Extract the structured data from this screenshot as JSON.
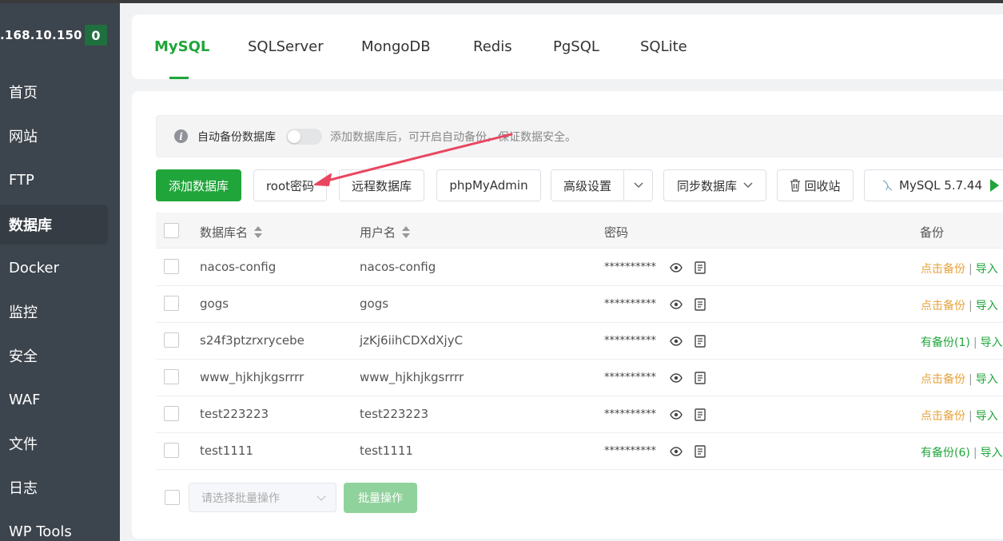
{
  "sidebar": {
    "server_ip": ".168.10.150",
    "badge": "0",
    "items": [
      {
        "label": "首页"
      },
      {
        "label": "网站"
      },
      {
        "label": "FTP"
      },
      {
        "label": "数据库"
      },
      {
        "label": "Docker"
      },
      {
        "label": "监控"
      },
      {
        "label": "安全"
      },
      {
        "label": "WAF"
      },
      {
        "label": "文件"
      },
      {
        "label": "日志"
      },
      {
        "label": "WP Tools"
      }
    ],
    "active_item": "数据库"
  },
  "tabs": [
    "MySQL",
    "SQLServer",
    "MongoDB",
    "Redis",
    "PgSQL",
    "SQLite"
  ],
  "active_tab": "MySQL",
  "notice": {
    "label": "自动备份数据库",
    "text": "添加数据库后，可开启自动备份，保证数据安全。",
    "toggle_on": false
  },
  "toolbar": {
    "add_db": "添加数据库",
    "root_pwd": "root密码",
    "remote_db": "远程数据库",
    "phpmyadmin": "phpMyAdmin",
    "advanced": "高级设置",
    "sync_db": "同步数据库",
    "recycle": "回收站",
    "mysql_version": "MySQL 5.7.44"
  },
  "table": {
    "headers": {
      "db_name": "数据库名",
      "username": "用户名",
      "password": "密码",
      "backup": "备份"
    },
    "rows": [
      {
        "db_name": "nacos-config",
        "username": "nacos-config",
        "password": "**********",
        "backup": "点击备份",
        "backup_state": "none",
        "import": "导入"
      },
      {
        "db_name": "gogs",
        "username": "gogs",
        "password": "**********",
        "backup": "点击备份",
        "backup_state": "none",
        "import": "导入"
      },
      {
        "db_name": "s24f3ptzrxrycebe",
        "username": "jzKj6iihCDXdXjyC",
        "password": "**********",
        "backup": "有备份(1)",
        "backup_state": "has",
        "import": "导入"
      },
      {
        "db_name": "www_hjkhjkgsrrrr",
        "username": "www_hjkhjkgsrrrr",
        "password": "**********",
        "backup": "点击备份",
        "backup_state": "none",
        "import": "导入"
      },
      {
        "db_name": "test223223",
        "username": "test223223",
        "password": "**********",
        "backup": "点击备份",
        "backup_state": "none",
        "import": "导入"
      },
      {
        "db_name": "test1111",
        "username": "test1111",
        "password": "**********",
        "backup": "有备份(6)",
        "backup_state": "has",
        "import": "导入"
      }
    ]
  },
  "bottom": {
    "batch_placeholder": "请选择批量操作",
    "batch_button": "批量操作"
  },
  "colors": {
    "accent": "#20a53a",
    "sidebar": "#3c444d",
    "warning": "#e6a23c",
    "annotation_arrow": "#e8475f"
  }
}
